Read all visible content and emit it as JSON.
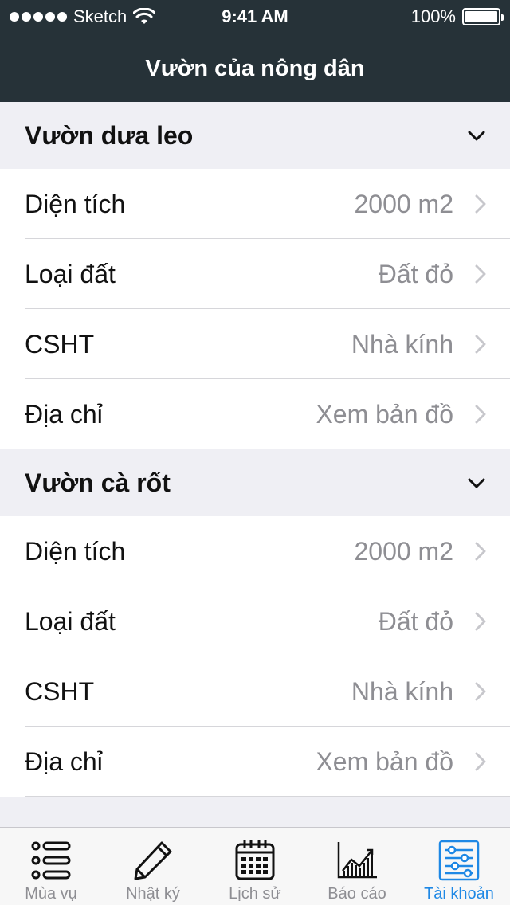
{
  "status": {
    "carrier": "Sketch",
    "time": "9:41 AM",
    "battery": "100%"
  },
  "nav": {
    "title": "Vườn của nông dân"
  },
  "sections": [
    {
      "title": "Vườn dưa leo",
      "rows": [
        {
          "label": "Diện tích",
          "value": "2000 m2"
        },
        {
          "label": "Loại đất",
          "value": "Đất đỏ"
        },
        {
          "label": "CSHT",
          "value": "Nhà kính"
        },
        {
          "label": "Địa chỉ",
          "value": "Xem bản đồ"
        }
      ]
    },
    {
      "title": "Vườn cà rốt",
      "rows": [
        {
          "label": "Diện tích",
          "value": "2000 m2"
        },
        {
          "label": "Loại đất",
          "value": "Đất đỏ"
        },
        {
          "label": "CSHT",
          "value": "Nhà kính"
        },
        {
          "label": "Địa chỉ",
          "value": "Xem bản đồ"
        }
      ]
    }
  ],
  "tabs": [
    {
      "label": "Mùa vụ",
      "icon": "list-icon"
    },
    {
      "label": "Nhật ký",
      "icon": "pencil-icon"
    },
    {
      "label": "Lịch sử",
      "icon": "calendar-icon"
    },
    {
      "label": "Báo cáo",
      "icon": "chart-icon"
    },
    {
      "label": "Tài khoản",
      "icon": "sliders-icon",
      "active": true
    }
  ],
  "colors": {
    "nav_bg": "#263238",
    "active_tab": "#1e88e5",
    "inactive_tab": "#8e8e93"
  }
}
